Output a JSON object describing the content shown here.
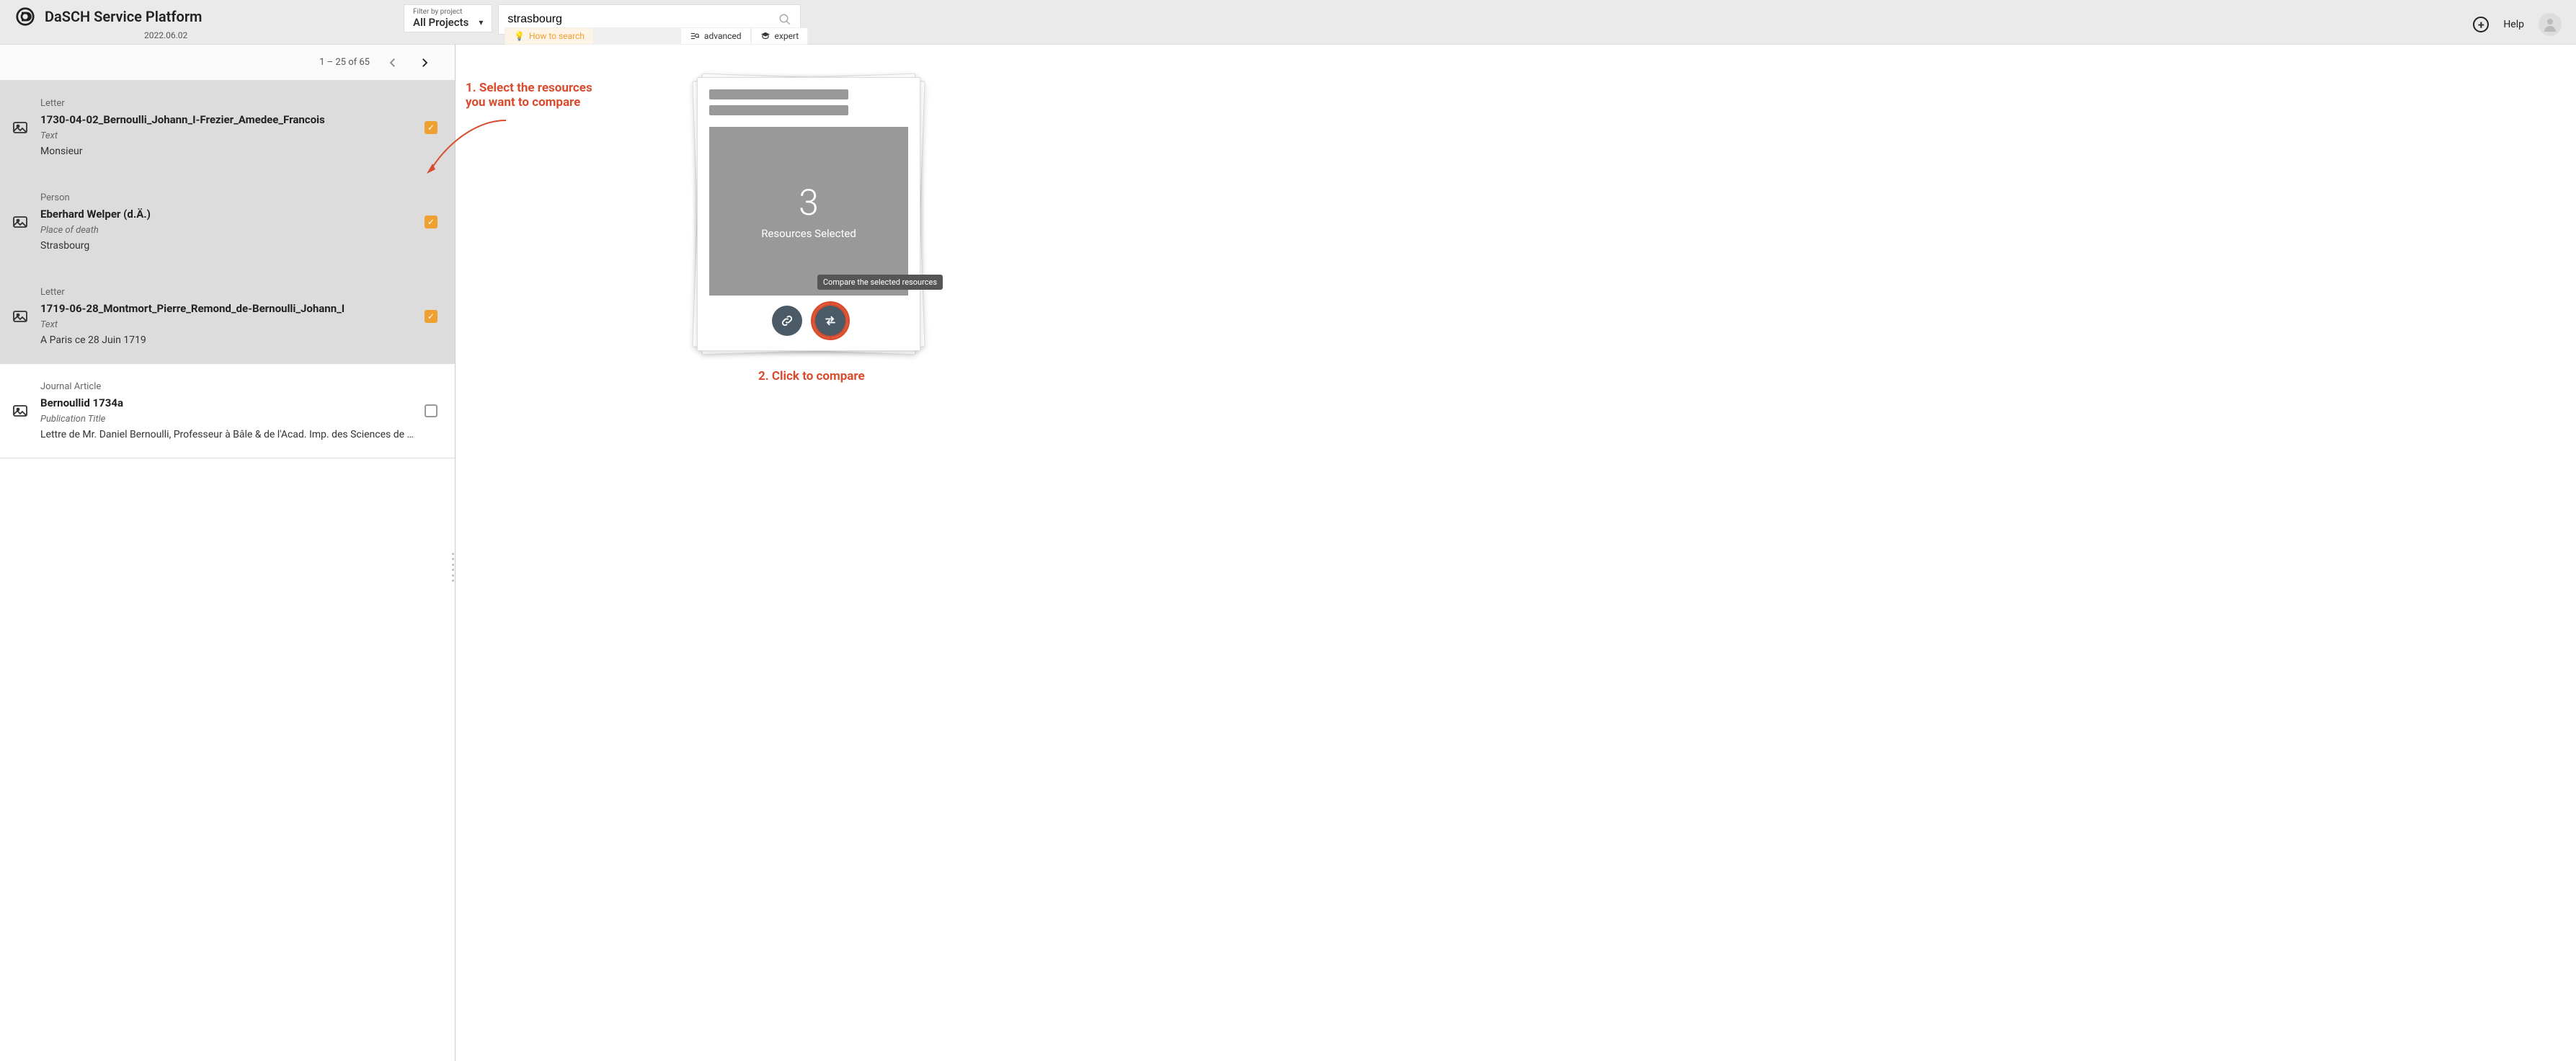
{
  "header": {
    "brand": "DaSCH Service Platform",
    "version": "2022.06.02",
    "filter_label": "Filter by project",
    "filter_value": "All Projects",
    "search_value": "strasbourg",
    "how_to_search": "How to search",
    "advanced": "advanced",
    "expert": "expert",
    "help": "Help"
  },
  "pager": {
    "text": "1 – 25 of 65"
  },
  "results": [
    {
      "type": "Letter",
      "title": "1730-04-02_Bernoulli_Johann_I-Frezier_Amedee_Francois",
      "field": "Text",
      "value": "Monsieur",
      "selected": true
    },
    {
      "type": "Person",
      "title": "Eberhard Welper (d.Ä.)",
      "field": "Place of death",
      "value": "Strasbourg",
      "selected": true
    },
    {
      "type": "Letter",
      "title": "1719-06-28_Montmort_Pierre_Remond_de-Bernoulli_Johann_I",
      "field": "Text",
      "value": "A Paris ce 28 Juin 1719",
      "selected": true
    },
    {
      "type": "Journal Article",
      "title": "Bernoullid 1734a",
      "field": "Publication Title",
      "value": "Lettre de Mr. Daniel Bernoulli, Professeur à Bâle & de l'Acad. Imp. des Sciences de Petersbour…",
      "selected": false
    }
  ],
  "compare": {
    "count": "3",
    "label": "Resources Selected",
    "tooltip": "Compare the selected resources"
  },
  "annotations": {
    "step1a": "1. Select the resources",
    "step1b": "you want to compare",
    "step2": "2. Click to compare"
  }
}
